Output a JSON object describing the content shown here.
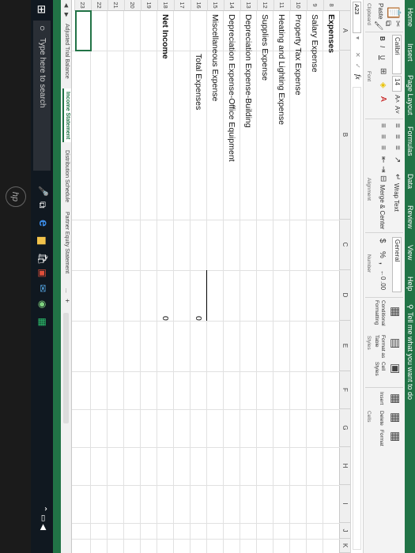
{
  "ribbon_tabs": [
    "Home",
    "Insert",
    "Page Layout",
    "Formulas",
    "Data",
    "Review",
    "View",
    "Help"
  ],
  "tell_me": "Tell me what you want to do",
  "ribbon": {
    "paste": "Paste",
    "clipboard": "Clipboard",
    "font_name": "Calibri",
    "font_size": "14",
    "bold": "B",
    "italic": "I",
    "underline": "U",
    "font_group": "Font",
    "wrap_text": "Wrap Text",
    "merge_center": "Merge & Center",
    "alignment_group": "Alignment",
    "number_format": "General",
    "currency": "$",
    "percent": "%",
    "comma": ",",
    "number_group": "Number",
    "conditional_formatting": "Conditional Formatting",
    "format_as_table": "Format as Table",
    "cell_styles": "Cell Styles",
    "styles_group": "Styles",
    "insert": "Insert",
    "delete": "Delete",
    "format": "Format",
    "cells_group": "Cells"
  },
  "formula_bar": {
    "name_box": "A23",
    "fx": "fx",
    "cancel": "✕",
    "enter": "✓"
  },
  "columns": [
    "A",
    "B",
    "C",
    "D",
    "E",
    "F",
    "G",
    "H",
    "I",
    "J",
    "K"
  ],
  "rows": [
    "8",
    "9",
    "10",
    "11",
    "12",
    "13",
    "14",
    "15",
    "16",
    "17",
    "18",
    "19",
    "20",
    "21",
    "22",
    "23"
  ],
  "cells": {
    "expenses": "Expenses",
    "salary": "Salary Expense",
    "property_tax": "Property Tax Expense",
    "heating": "Heating and Lighting Expense",
    "supplies": "Supplies Expense",
    "dep_building": "Depreciation Expense-Building",
    "dep_equipment": "Depreciation Expense-Office Equipment",
    "misc": "Miscellaneous Expense",
    "total_expenses": "Total Expenses",
    "total_value": "0",
    "net_income": "Net Income",
    "net_value": "0"
  },
  "sheet_tabs": [
    "Adjusted Trial Balance",
    "Income Statement",
    "Distribution Schedule",
    "Partner Equity Statement"
  ],
  "active_sheet": "Income Statement",
  "sheet_more": "...",
  "add_sheet": "+",
  "search_placeholder": "Type here to search",
  "laptop_logo": "hp",
  "colors": {
    "excel_green": "#217346",
    "taskbar": "#101820"
  }
}
